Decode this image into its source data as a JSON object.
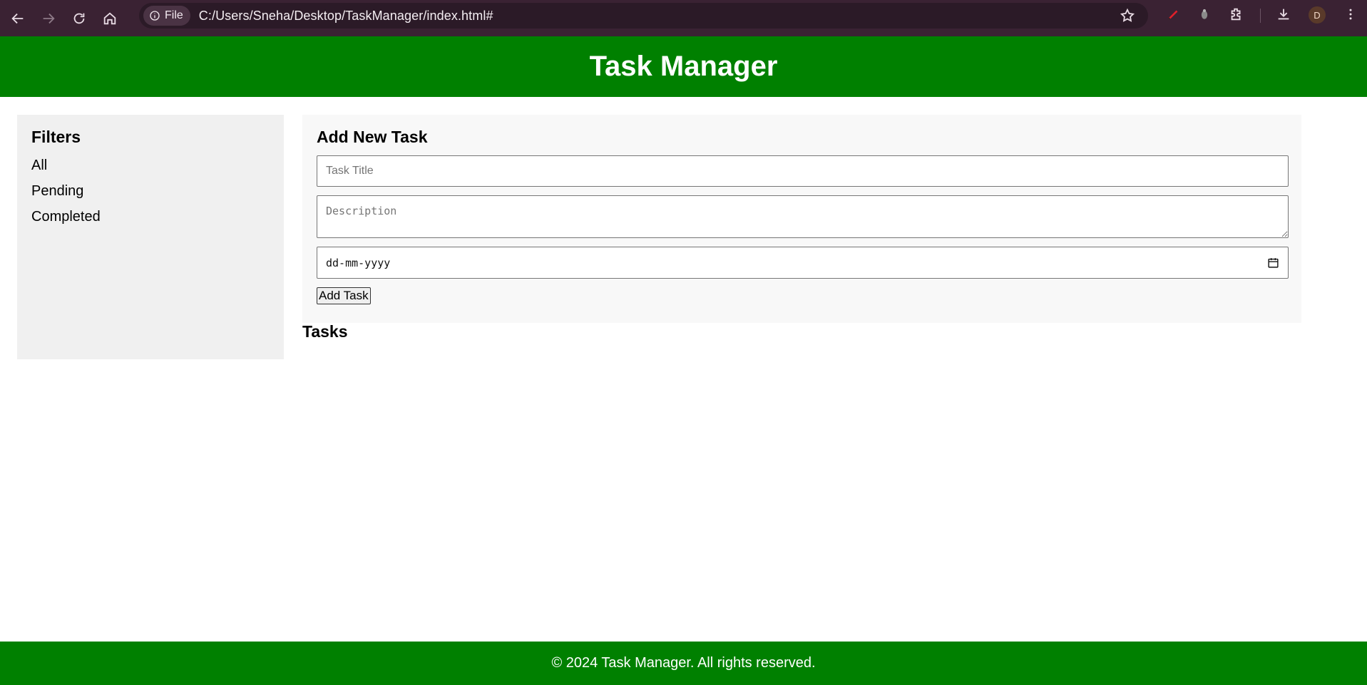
{
  "browser": {
    "url": "C:/Users/Sneha/Desktop/TaskManager/index.html#",
    "file_chip_label": "File",
    "profile_initial": "D"
  },
  "header": {
    "title": "Task Manager"
  },
  "sidebar": {
    "title": "Filters",
    "items": [
      {
        "label": "All"
      },
      {
        "label": "Pending"
      },
      {
        "label": "Completed"
      }
    ]
  },
  "form": {
    "title": "Add New Task",
    "title_placeholder": "Task Title",
    "description_placeholder": "Description",
    "date_placeholder": "dd-mm-yyyy",
    "submit_label": "Add Task"
  },
  "tasks": {
    "title": "Tasks"
  },
  "footer": {
    "text": "© 2024 Task Manager. All rights reserved."
  },
  "colors": {
    "brand": "#008000",
    "chrome": "#3a2233"
  }
}
